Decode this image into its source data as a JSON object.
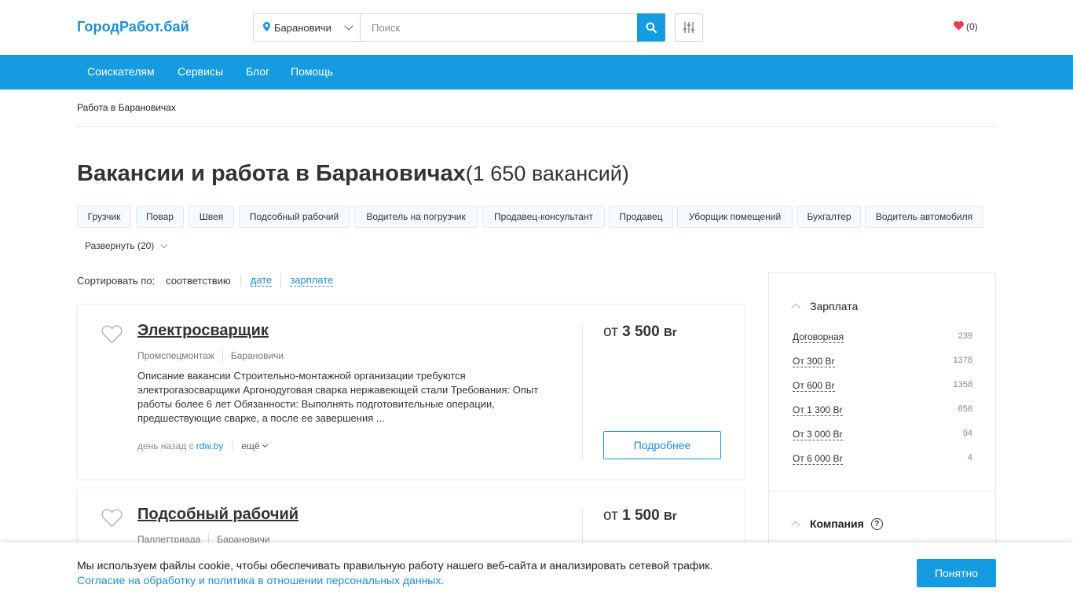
{
  "header": {
    "logo": "ГородРабот.бай",
    "city": "Барановичи",
    "search_placeholder": "Поиск",
    "favorites_count": "(0)"
  },
  "nav": {
    "items": [
      "Соискателям",
      "Сервисы",
      "Блог",
      "Помощь"
    ]
  },
  "breadcrumb": "Работа в Барановичах",
  "page": {
    "title": "Вакансии и работа в Барановичах",
    "count": "(1 650 вакансий)"
  },
  "tags": {
    "items": [
      "Грузчик",
      "Повар",
      "Швея",
      "Подсобный рабочий",
      "Водитель на погрузчик",
      "Продавец-консультант",
      "Продавец",
      "Уборщик помещений",
      "Бухгалтер",
      "Водитель автомобиля"
    ],
    "expand_label": "Развернуть (20)"
  },
  "sort": {
    "label": "Сортировать по:",
    "active": "соответствию",
    "options": [
      "дате",
      "зарплате"
    ]
  },
  "vacancies": [
    {
      "title": "Электросварщик",
      "company": "Промспецмонтаж",
      "city": "Барановичи",
      "description": "Описание вакансии Строительно-монтажной организации требуются электрогазосварщики Аргонодуговая сварка нержавеющей стали Требования: Опыт работы более 6 лет Обязанности: Выполнять подготовительные операции, предшествующие сварке, а после ее завершения ...",
      "posted": "день назад с",
      "source": "rdw.by",
      "more": "ещё",
      "salary_prefix": "от",
      "salary_value": "3 500",
      "currency": "Br",
      "details_label": "Подробнее"
    },
    {
      "title": "Подсобный рабочий",
      "company": "Паллеттриада",
      "city": "Барановичи",
      "salary_prefix": "от",
      "salary_value": "1 500",
      "currency": "Br"
    }
  ],
  "sidebar": {
    "salary_title": "Зарплата",
    "salary_filters": [
      {
        "label": "Договорная",
        "count": "239"
      },
      {
        "label": "От 300 Br",
        "count": "1378"
      },
      {
        "label": "От 600 Br",
        "count": "1358"
      },
      {
        "label": "От 1 300 Br",
        "count": "858"
      },
      {
        "label": "От 3 000 Br",
        "count": "94"
      },
      {
        "label": "От 6 000 Br",
        "count": "4"
      }
    ],
    "company_title": "Компания",
    "help_icon": "?"
  },
  "cookie": {
    "text": "Мы используем файлы cookie, чтобы обеспечивать правильную работу нашего веб-сайта и анализировать сетевой трафик.",
    "policy_link": "Согласие на обработку и политика в отношении персональных данных.",
    "accept_label": "Понятно"
  },
  "colors": {
    "accent": "#149be0",
    "link": "#1a8ed8",
    "heart": "#e43d4f"
  }
}
